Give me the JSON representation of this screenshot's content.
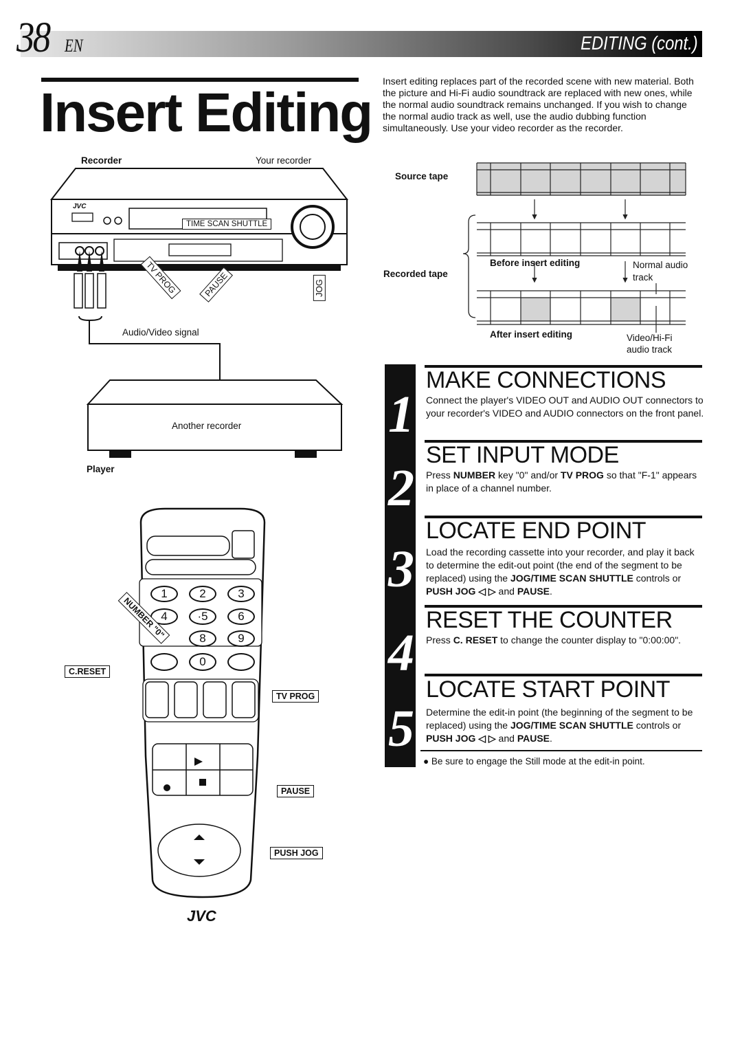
{
  "header": {
    "page_number": "38",
    "language": "EN",
    "section": "EDITING (cont.)"
  },
  "title": "Insert Editing",
  "intro": "Insert editing replaces part of the recorded scene with new material. Both the picture and Hi-Fi audio soundtrack are replaced with new ones, while the normal audio soundtrack remains unchanged. If you wish to change the normal audio track as well, use the audio dubbing function simultaneously. Use your video recorder as the recorder.",
  "diagram": {
    "source_tape": "Source tape",
    "recorded_tape": "Recorded tape",
    "before": "Before insert editing",
    "after": "After insert editing",
    "normal_audio": "Normal audio",
    "normal_audio_2": "track",
    "video_hifi": "Video/Hi-Fi",
    "video_hifi_2": "audio track",
    "replaced_cells": [
      2,
      5
    ]
  },
  "illustration": {
    "recorder_label": "Recorder",
    "your_recorder": "Your recorder",
    "brand": "JVC",
    "time_scan_shuttle": "TIME SCAN SHUTTLE",
    "tv_prog": "TV PROG",
    "pause": "PAUSE",
    "jog": "JOG",
    "av_signal": "Audio/Video signal",
    "another_recorder": "Another recorder",
    "player_label": "Player"
  },
  "remote": {
    "keys": [
      "1",
      "2",
      "3",
      "4",
      "·5",
      "6",
      "8",
      "9",
      "0"
    ],
    "number_callout": "NUMBER \"0\"",
    "c_reset": "C.RESET",
    "tv_prog": "TV PROG",
    "pause": "PAUSE",
    "push_jog": "PUSH JOG",
    "brand": "JVC"
  },
  "steps": [
    {
      "num": "1",
      "heading": "MAKE CONNECTIONS",
      "body": [
        {
          "t": "Connect the player's VIDEO OUT and AUDIO OUT connectors to your recorder's VIDEO and AUDIO connectors on the front panel."
        }
      ]
    },
    {
      "num": "2",
      "heading": "SET INPUT MODE",
      "body": [
        {
          "t": "Press "
        },
        {
          "t": "NUMBER",
          "b": true
        },
        {
          "t": " key \"0\" and/or "
        },
        {
          "t": "TV PROG",
          "b": true
        },
        {
          "t": " so that \"F-1\" appears in place of a channel number."
        }
      ]
    },
    {
      "num": "3",
      "heading": "LOCATE END POINT",
      "body": [
        {
          "t": "Load the recording cassette into your recorder, and play it back to determine the edit-out point (the end of the segment to be replaced) using the "
        },
        {
          "t": "JOG/TIME SCAN SHUTTLE",
          "b": true
        },
        {
          "t": " controls or "
        },
        {
          "t": "PUSH JOG ◁ ▷",
          "b": true
        },
        {
          "t": " and "
        },
        {
          "t": "PAUSE",
          "b": true
        },
        {
          "t": "."
        }
      ]
    },
    {
      "num": "4",
      "heading": "RESET THE COUNTER",
      "body": [
        {
          "t": "Press "
        },
        {
          "t": "C. RESET",
          "b": true
        },
        {
          "t": " to change the counter display to \"0:00:00\"."
        }
      ]
    },
    {
      "num": "5",
      "heading": "LOCATE START POINT",
      "body": [
        {
          "t": "Determine the edit-in point (the beginning of the segment to be replaced) using the "
        },
        {
          "t": "JOG/TIME SCAN SHUTTLE",
          "b": true
        },
        {
          "t": " controls or "
        },
        {
          "t": "PUSH JOG ◁ ▷",
          "b": true
        },
        {
          "t": " and "
        },
        {
          "t": "PAUSE",
          "b": true
        },
        {
          "t": "."
        }
      ]
    }
  ],
  "note": "● Be sure to engage the Still mode at the edit-in point."
}
